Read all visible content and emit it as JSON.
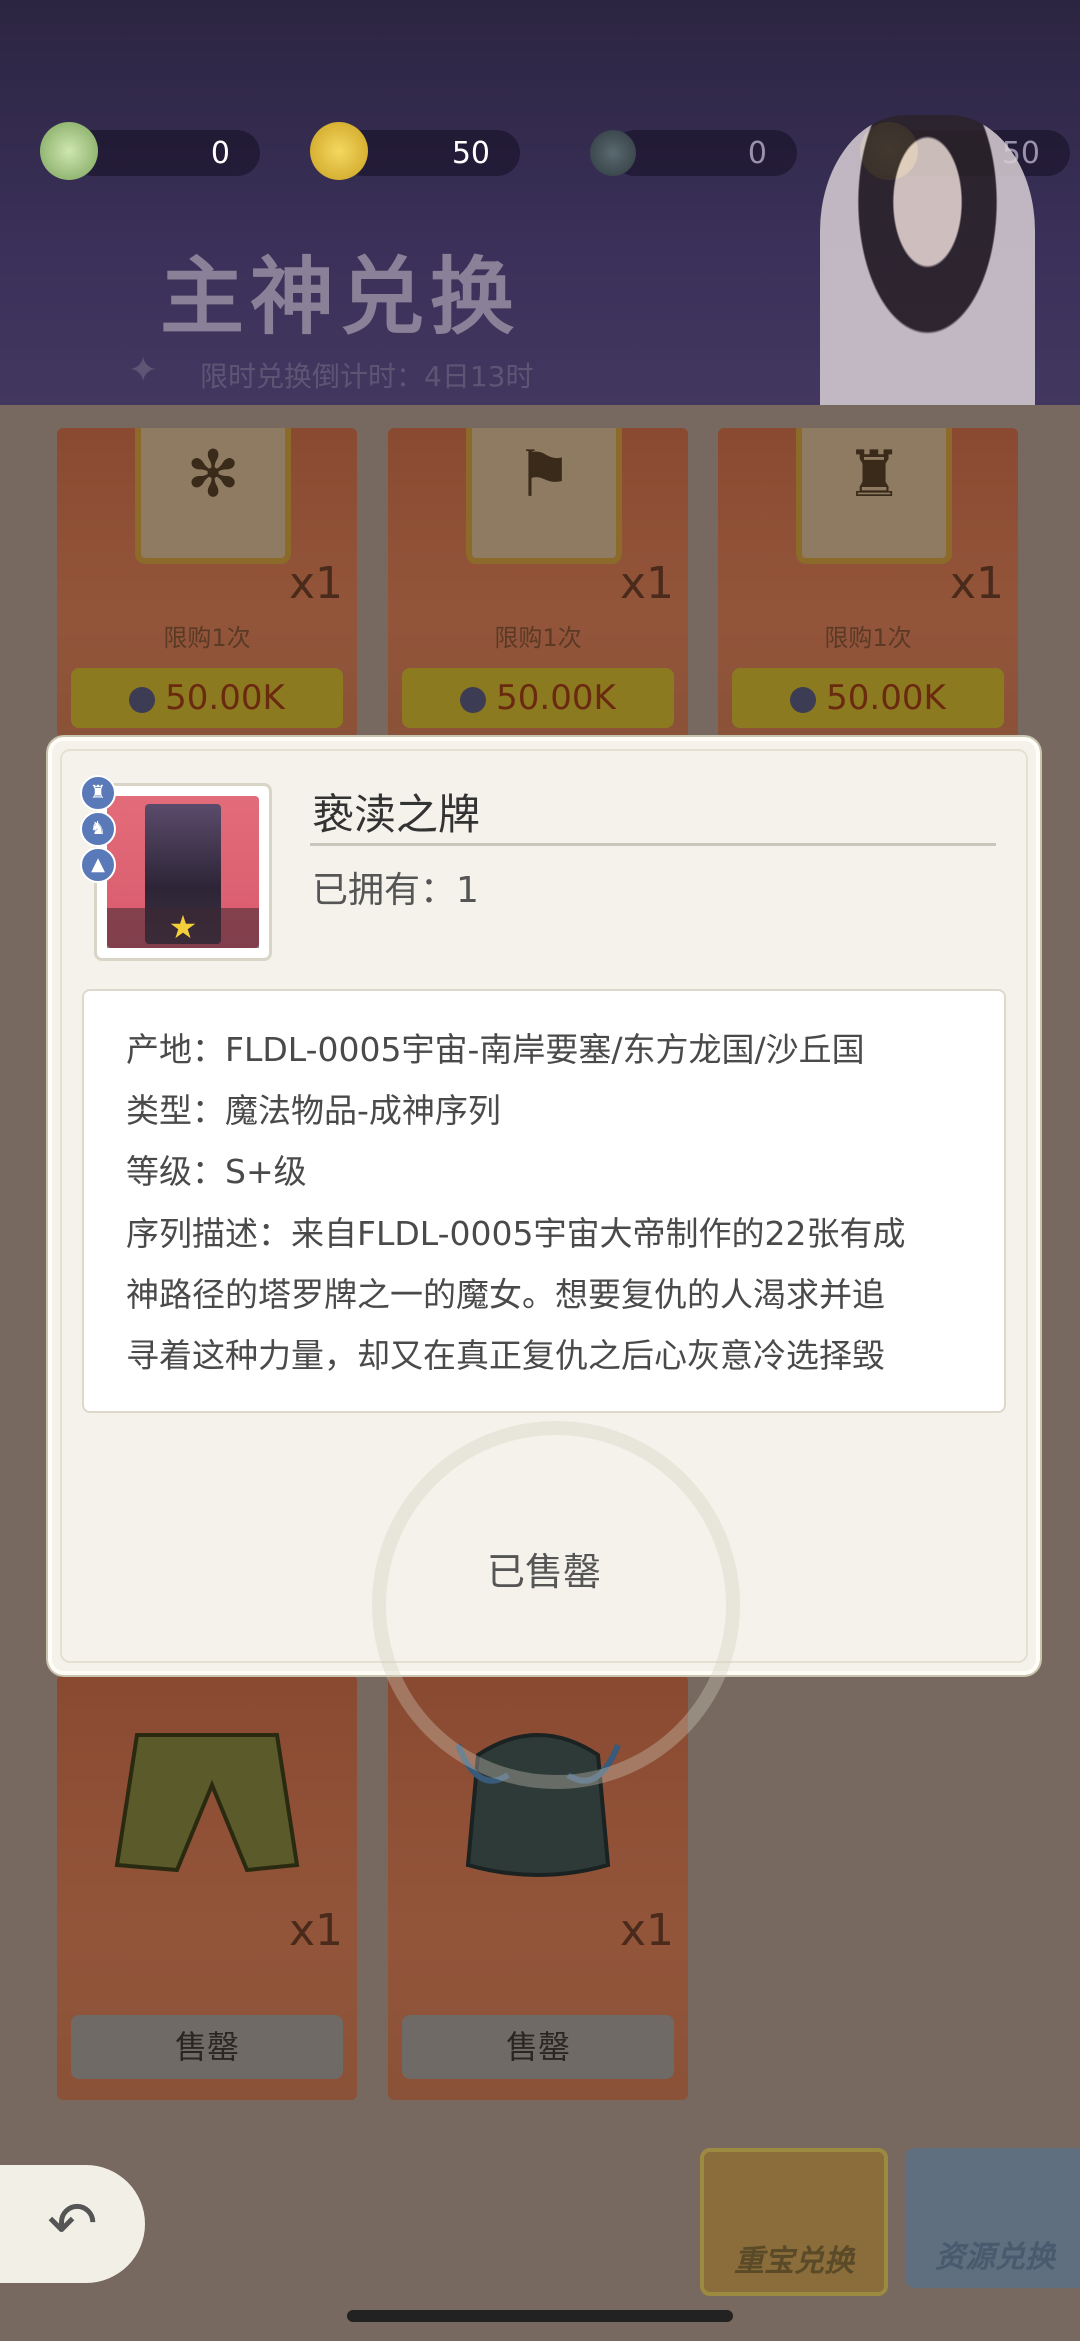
{
  "header": {
    "resources": [
      {
        "icon": "s-coin-icon",
        "value": "0"
      },
      {
        "icon": "gold-coin-icon",
        "value": "50"
      },
      {
        "icon": "gem-icon",
        "value": "0"
      },
      {
        "icon": "gold-medal-icon",
        "value": "50"
      }
    ],
    "title": "主神兑换",
    "countdown": "限时兑换倒计时：4日13时"
  },
  "shop": {
    "top_cards": [
      {
        "icon": "snowflake-icon",
        "qty": "x1",
        "limit": "限购1次",
        "price": "50.00K"
      },
      {
        "icon": "flag-icon",
        "qty": "x1",
        "limit": "限购1次",
        "price": "50.00K"
      },
      {
        "icon": "castle-icon",
        "qty": "x1",
        "limit": "限购1次",
        "price": "50.00K"
      }
    ],
    "bottom_cards": [
      {
        "icon": "pants-icon",
        "qty": "x1",
        "status": "售罄"
      },
      {
        "icon": "dragon-armor-icon",
        "qty": "x1",
        "status": "售罄"
      }
    ]
  },
  "modal": {
    "item_name": "亵渎之牌",
    "owned": "已拥有：1",
    "details": [
      "产地：FLDL-0005宇宙-南岸要塞/东方龙国/沙丘国",
      "类型：魔法物品-成神序列",
      "等级：S+级",
      "序列描述：来自FLDL-0005宇宙大帝制作的22张有成",
      "神路径的塔罗牌之一的魔女。想要复仇的人渴求并追",
      "寻着这种力量，却又在真正复仇之后心灰意冷选择毁"
    ],
    "status": "已售罄"
  },
  "bottom_tabs": {
    "treasure": "重宝兑换",
    "resource": "资源兑换"
  },
  "colors": {
    "accent_gold": "#f4cf3a",
    "card_red": "#93553a"
  }
}
